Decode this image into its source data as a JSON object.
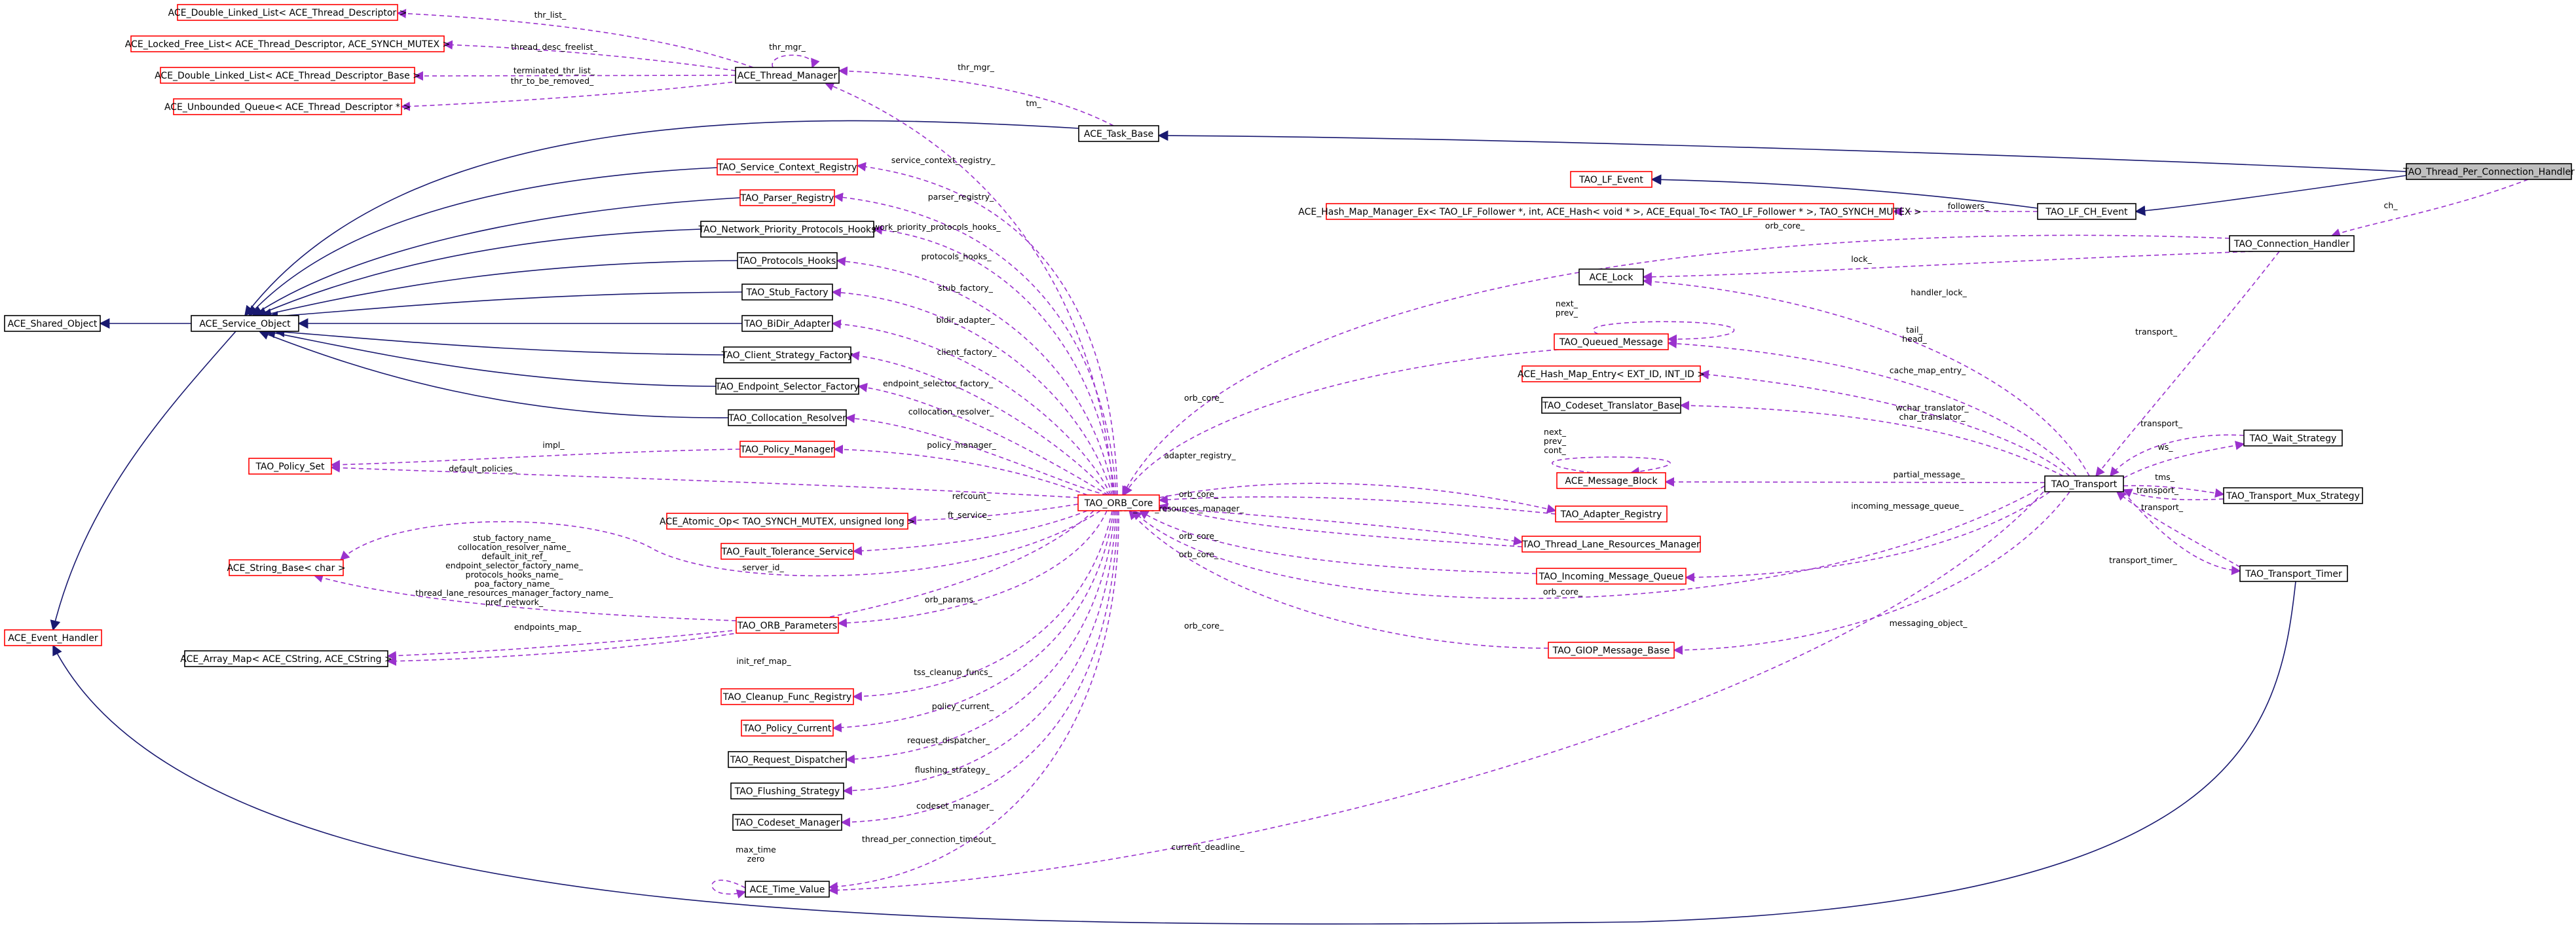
{
  "colors": {
    "usage_edge": "#9a32cd",
    "inheritance_edge": "#191970",
    "documented_border": "#000000",
    "undocumented_border": "#ff0000",
    "focus_fill": "#bfbfbf"
  },
  "nodes": {
    "thread_per_connection_handler": "TAO_Thread_Per_Connection_Handler",
    "task_base": "ACE_Task_Base",
    "thread_manager": "ACE_Thread_Manager",
    "dll_thread_descriptor": "ACE_Double_Linked_List< ACE_Thread_Descriptor >",
    "locked_free_list": "ACE_Locked_Free_List< ACE_Thread_Descriptor, ACE_SYNCH_MUTEX >",
    "dll_thread_descriptor_base": "ACE_Double_Linked_List< ACE_Thread_Descriptor_Base >",
    "unbounded_queue": "ACE_Unbounded_Queue< ACE_Thread_Descriptor * >",
    "lf_event": "TAO_LF_Event",
    "lf_ch_event": "TAO_LF_CH_Event",
    "hash_map_manager_ex": "ACE_Hash_Map_Manager_Ex< TAO_LF_Follower *, int, ACE_Hash< void * >, ACE_Equal_To< TAO_LF_Follower * >, TAO_SYNCH_MUTEX >",
    "connection_handler": "TAO_Connection_Handler",
    "ace_lock": "ACE_Lock",
    "service_context_registry": "TAO_Service_Context_Registry",
    "parser_registry": "TAO_Parser_Registry",
    "network_priority_protocols_hooks": "TAO_Network_Priority_Protocols_Hooks",
    "protocols_hooks": "TAO_Protocols_Hooks",
    "stub_factory": "TAO_Stub_Factory",
    "bidir_adapter": "TAO_BiDir_Adapter",
    "client_strategy_factory": "TAO_Client_Strategy_Factory",
    "endpoint_selector_factory": "TAO_Endpoint_Selector_Factory",
    "collocation_resolver": "TAO_Collocation_Resolver",
    "shared_object": "ACE_Shared_Object",
    "service_object": "ACE_Service_Object",
    "policy_set": "TAO_Policy_Set",
    "policy_manager": "TAO_Policy_Manager",
    "orb_core": "TAO_ORB_Core",
    "atomic_op": "ACE_Atomic_Op< TAO_SYNCH_MUTEX, unsigned long >",
    "fault_tolerance_service": "TAO_Fault_Tolerance_Service",
    "string_base": "ACE_String_Base< char >",
    "event_handler": "ACE_Event_Handler",
    "orb_parameters": "TAO_ORB_Parameters",
    "array_map": "ACE_Array_Map< ACE_CString, ACE_CString >",
    "cleanup_func_registry": "TAO_Cleanup_Func_Registry",
    "policy_current": "TAO_Policy_Current",
    "request_dispatcher": "TAO_Request_Dispatcher",
    "flushing_strategy": "TAO_Flushing_Strategy",
    "codeset_manager": "TAO_Codeset_Manager",
    "time_value": "ACE_Time_Value",
    "queued_message": "TAO_Queued_Message",
    "hash_map_entry": "ACE_Hash_Map_Entry< EXT_ID, INT_ID >",
    "codeset_translator_base": "TAO_Codeset_Translator_Base",
    "message_block": "ACE_Message_Block",
    "adapter_registry": "TAO_Adapter_Registry",
    "thread_lane_resources_manager": "TAO_Thread_Lane_Resources_Manager",
    "incoming_message_queue": "TAO_Incoming_Message_Queue",
    "giop_message_base": "TAO_GIOP_Message_Base",
    "transport": "TAO_Transport",
    "wait_strategy": "TAO_Wait_Strategy",
    "transport_mux_strategy": "TAO_Transport_Mux_Strategy",
    "transport_timer": "TAO_Transport_Timer"
  },
  "edge_labels": {
    "ch": "ch_",
    "thr_list": "thr_list_",
    "thread_desc_freelist": "thread_desc_freelist_",
    "terminated_thr_list": "terminated_thr_list_",
    "thr_to_be_removed": "thr_to_be_removed_",
    "thr_mgr_self": "thr_mgr_",
    "thr_mgr": "thr_mgr_",
    "tm": "tm_",
    "followers": "followers_",
    "orb_core_ch": "orb_core_",
    "lock": "lock_",
    "service_context_registry": "service_context_registry_",
    "parser_registry": "parser_registry_",
    "network_priority_protocols_hooks": "network_priority_protocols_hooks_",
    "protocols_hooks": "protocols_hooks_",
    "stub_factory": "stub_factory_",
    "bidir_adapter": "bidir_adapter_",
    "client_factory": "client_factory_",
    "endpoint_selector_factory": "endpoint_selector_factory_",
    "collocation_resolver": "collocation_resolver_",
    "impl": "impl_",
    "policy_manager": "policy_manager_",
    "default_policies": "default_policies_",
    "refcount": "refcount_",
    "ft_service": "ft_service_",
    "server_id": "server_id_",
    "string_members": "stub_factory_name_\ncollocation_resolver_name_\ndefault_init_ref_\nendpoint_selector_factory_name_\nprotocols_hooks_name_\npoa_factory_name_\nthread_lane_resources_manager_factory_name_\npref_network_",
    "orb_params": "orb_params_",
    "endpoints_map": "endpoints_map_",
    "init_ref_map": "init_ref_map_",
    "tss_cleanup_funcs": "tss_cleanup_funcs_",
    "policy_current": "policy_current_",
    "request_dispatcher": "request_dispatcher_",
    "flushing_strategy": "flushing_strategy_",
    "codeset_manager": "codeset_manager_",
    "thread_per_connection_timeout": "thread_per_connection_timeout_",
    "max_time_zero": "max_time\nzero",
    "orb_core_qm": "orb_core_",
    "next_prev_qm": "next_\nprev_",
    "adapter_registry": "adapter_registry_",
    "orb_core_ar": "orb_core_",
    "thread_lane_resources_manager": "thread_lane_resources_manager_",
    "orb_core_tlrm": "orb_core_",
    "orb_core_imq": "orb_core_",
    "orb_core_transport": "orb_core_",
    "orb_core_giop": "orb_core_",
    "next_prev_cont": "next_\nprev_\ncont_",
    "handler_lock": "handler_lock_",
    "tail_head": "tail_\nhead_",
    "cache_map_entry": "cache_map_entry_",
    "wchar_char_translator": "wchar_translator_\nchar_translator_",
    "partial_message": "partial_message_",
    "incoming_message_queue": "incoming_message_queue_",
    "messaging_object": "messaging_object_",
    "current_deadline": "current_deadline_",
    "transport_ch": "transport_",
    "transport_ws": "transport_",
    "ws": "ws_",
    "tms": "tms_",
    "transport_tms": "transport_",
    "transport_timer": "transport_timer_",
    "transport_tt": "transport_"
  }
}
